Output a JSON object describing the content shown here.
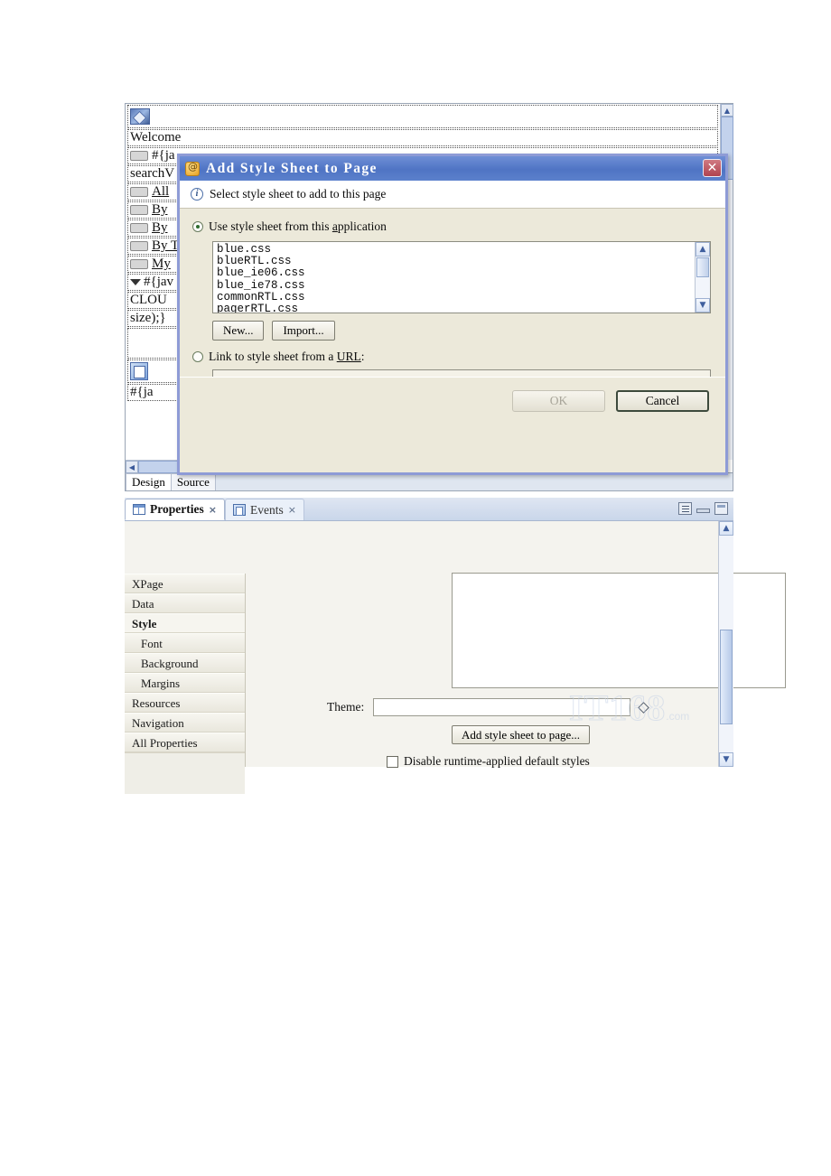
{
  "editor": {
    "lines": [
      {
        "type": "image",
        "text": ""
      },
      {
        "type": "text",
        "text": "Welcome"
      },
      {
        "type": "tag",
        "text": "#{ja"
      },
      {
        "type": "input",
        "text": "searchV"
      },
      {
        "type": "taglink",
        "text": "All "
      },
      {
        "type": "taglink",
        "text": "By "
      },
      {
        "type": "taglink",
        "text": "By "
      },
      {
        "type": "taglink",
        "text": "By T"
      },
      {
        "type": "taglink",
        "text": "My"
      },
      {
        "type": "tri",
        "text": "#{jav"
      },
      {
        "type": "text",
        "text": "CLOU"
      },
      {
        "type": "text",
        "text": "size);}"
      },
      {
        "type": "blank",
        "text": ""
      },
      {
        "type": "stack",
        "text": ""
      },
      {
        "type": "text",
        "text": "#{ja"
      }
    ],
    "tabs": [
      {
        "label": "Design",
        "active": true
      },
      {
        "label": "Source",
        "active": false
      }
    ]
  },
  "properties_panel": {
    "tabs": [
      {
        "label": "Properties",
        "icon": "grid-icon",
        "active": true,
        "close": "×"
      },
      {
        "label": "Events",
        "icon": "events-icon",
        "active": false,
        "close": "×"
      }
    ],
    "tools": [
      "menu-icon",
      "minimize-icon",
      "maximize-icon"
    ],
    "sidebar": [
      {
        "label": "XPage",
        "sub": false,
        "active": false
      },
      {
        "label": "Data",
        "sub": false,
        "active": false
      },
      {
        "label": "Style",
        "sub": false,
        "active": true
      },
      {
        "label": "Font",
        "sub": true,
        "active": false
      },
      {
        "label": "Background",
        "sub": true,
        "active": false
      },
      {
        "label": "Margins",
        "sub": true,
        "active": false
      },
      {
        "label": "Resources",
        "sub": false,
        "active": false
      },
      {
        "label": "Navigation",
        "sub": false,
        "active": false
      },
      {
        "label": "All Properties",
        "sub": false,
        "active": false
      }
    ],
    "style_pane": {
      "style_textarea_value": "",
      "theme_label": "Theme:",
      "theme_value": "",
      "add_style_sheet_button": "Add style sheet to page...",
      "disable_checkbox_label": "Disable runtime-applied default styles",
      "disable_checkbox_checked": false
    }
  },
  "dialog": {
    "title": "Add Style Sheet to Page",
    "close_label": "✕",
    "info_text": "Select style sheet to add to this page",
    "option_application": {
      "label_prefix": "Use style sheet from this ",
      "label_underlined": "a",
      "label_suffix": "pplication",
      "selected": true
    },
    "stylesheets": [
      "blue.css",
      "blueRTL.css",
      "blue_ie06.css",
      "blue_ie78.css",
      "commonRTL.css",
      "pagerRTL.css"
    ],
    "buttons": {
      "new": "New...",
      "import": "Import..."
    },
    "option_url": {
      "label_prefix": "Link to style sheet from a ",
      "label_underlined": "URL",
      "label_suffix": ":",
      "selected": false,
      "value": ""
    },
    "footer": {
      "ok": "OK",
      "ok_enabled": false,
      "cancel": "Cancel",
      "cancel_default": true
    }
  },
  "watermark": {
    "text": "IT168",
    "suffix": ".com"
  },
  "colors": {
    "dialog_title_blue": "#4f74c4",
    "dialog_border": "#8e9bd6",
    "dialog_bg": "#ece9da",
    "panel_bg": "#f4f3ee",
    "close_red": "#b0434f"
  }
}
